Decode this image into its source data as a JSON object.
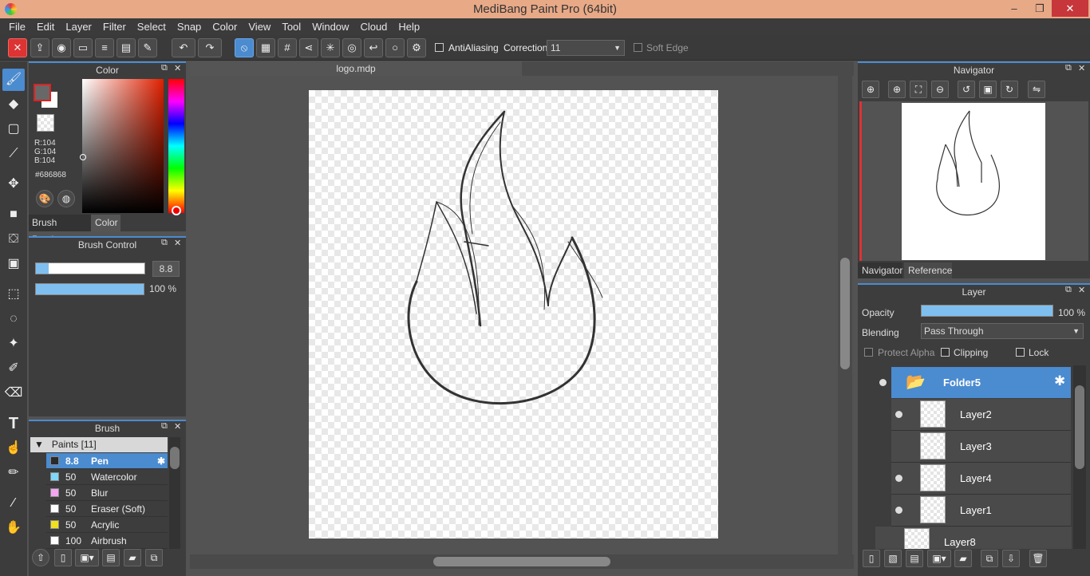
{
  "window": {
    "title": "MediBang Paint Pro (64bit)",
    "min": "–",
    "max": "❐",
    "close": "✕"
  },
  "menu": [
    "File",
    "Edit",
    "Layer",
    "Filter",
    "Select",
    "Snap",
    "Color",
    "View",
    "Tool",
    "Window",
    "Cloud",
    "Help"
  ],
  "toolbar": {
    "antialiasing_label": "AntiAliasing",
    "correction_label": "Correction",
    "correction_value": "11",
    "soft_edge_label": "Soft Edge"
  },
  "color_panel": {
    "title": "Color",
    "r": "R:104",
    "g": "G:104",
    "b": "B:104",
    "hex": "#686868",
    "tabs": [
      "Brush Preview",
      "Color"
    ],
    "fg_color": "#686868",
    "bg_color": "#ffffff",
    "fg_border": "#e02020"
  },
  "brush_control": {
    "title": "Brush Control",
    "size_value": "8.8",
    "size_fraction": 0.12,
    "opacity_label": "100 %",
    "opacity_fraction": 1.0
  },
  "brush_panel": {
    "title": "Brush",
    "group": "Paints [11]",
    "items": [
      {
        "size": "8.8",
        "name": "Pen",
        "color": "#2a2a2a",
        "selected": true
      },
      {
        "size": "50",
        "name": "Watercolor",
        "color": "#7fd8f8",
        "selected": false
      },
      {
        "size": "50",
        "name": "Blur",
        "color": "#f3a6f0",
        "selected": false
      },
      {
        "size": "50",
        "name": "Eraser (Soft)",
        "color": "#ffffff",
        "selected": false
      },
      {
        "size": "50",
        "name": "Acrylic",
        "color": "#f0e020",
        "selected": false
      },
      {
        "size": "100",
        "name": "Airbrush",
        "color": "#ffffff",
        "selected": false
      }
    ]
  },
  "document": {
    "tab_title": "logo.mdp"
  },
  "navigator": {
    "title": "Navigator",
    "tabs": [
      "Navigator",
      "Reference"
    ]
  },
  "layer_panel": {
    "title": "Layer",
    "opacity_label": "Opacity",
    "opacity_value": "100 %",
    "opacity_fraction": 1.0,
    "blending_label": "Blending",
    "blending_value": "Pass Through",
    "protect_alpha": "Protect Alpha",
    "clipping": "Clipping",
    "lock": "Lock",
    "folder": "Folder5",
    "layers": [
      {
        "name": "Layer2",
        "visible": true
      },
      {
        "name": "Layer3",
        "visible": false
      },
      {
        "name": "Layer4",
        "visible": true
      },
      {
        "name": "Layer1",
        "visible": true
      }
    ],
    "outer_layer": "Layer8"
  }
}
